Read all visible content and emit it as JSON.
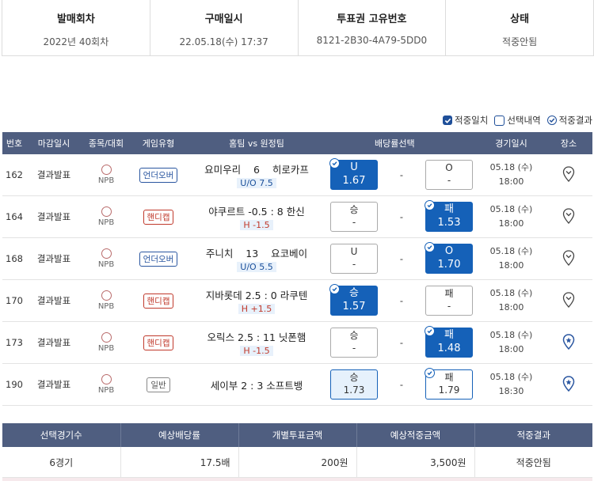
{
  "summary_header": [
    {
      "label": "발매회차",
      "value": "2022년 40회차"
    },
    {
      "label": "구매일시",
      "value": "22.05.18(수) 17:37"
    },
    {
      "label": "투표권 고유번호",
      "value": "8121-2B30-4A79-5DD0"
    },
    {
      "label": "상태",
      "value": "적중안됨"
    }
  ],
  "legend": {
    "hit_match": "적중일치",
    "selection": "선택내역",
    "hit_result": "적중결과"
  },
  "columns": [
    "번호",
    "마감일시",
    "종목/대회",
    "게임유형",
    "홈팀 vs 원정팀",
    "배당률선택",
    "경기일시",
    "장소"
  ],
  "rows": [
    {
      "no": "162",
      "deadline": "결과발표",
      "league": "NPB",
      "type": "언더오버",
      "type_kind": "uo",
      "match": "요미우리    6    히로카프",
      "sub": "U/O 7.5",
      "sub_kind": "uo",
      "left": {
        "label": "U",
        "odds": "1.67",
        "style": "sel",
        "check": true
      },
      "mid": "-",
      "right": {
        "label": "O",
        "odds": "-",
        "style": "plain",
        "check": false
      },
      "date": "05.18 (수)",
      "time": "18:00",
      "pin": "outline"
    },
    {
      "no": "164",
      "deadline": "결과발표",
      "league": "NPB",
      "type": "핸디캡",
      "type_kind": "hd",
      "match": "야쿠르트 -0.5 : 8 한신",
      "sub": "H -1.5",
      "sub_kind": "hd",
      "left": {
        "label": "승",
        "odds": "-",
        "style": "plain",
        "check": false
      },
      "mid": "-",
      "right": {
        "label": "패",
        "odds": "1.53",
        "style": "sel",
        "check": true
      },
      "date": "05.18 (수)",
      "time": "18:00",
      "pin": "outline"
    },
    {
      "no": "168",
      "deadline": "결과발표",
      "league": "NPB",
      "type": "언더오버",
      "type_kind": "uo",
      "match": "주니치    13    요코베이",
      "sub": "U/O 5.5",
      "sub_kind": "uo",
      "left": {
        "label": "U",
        "odds": "-",
        "style": "plain",
        "check": false
      },
      "mid": "-",
      "right": {
        "label": "O",
        "odds": "1.70",
        "style": "sel",
        "check": true
      },
      "date": "05.18 (수)",
      "time": "18:00",
      "pin": "outline"
    },
    {
      "no": "170",
      "deadline": "결과발표",
      "league": "NPB",
      "type": "핸디캡",
      "type_kind": "hd",
      "match": "지바롯데 2.5 : 0 라쿠텐",
      "sub": "H +1.5",
      "sub_kind": "hd",
      "left": {
        "label": "승",
        "odds": "1.57",
        "style": "sel",
        "check": true
      },
      "mid": "-",
      "right": {
        "label": "패",
        "odds": "-",
        "style": "plain",
        "check": false
      },
      "date": "05.18 (수)",
      "time": "18:00",
      "pin": "outline"
    },
    {
      "no": "173",
      "deadline": "결과발표",
      "league": "NPB",
      "type": "핸디캡",
      "type_kind": "hd",
      "match": "오릭스 2.5 : 11 닛폰햄",
      "sub": "H -1.5",
      "sub_kind": "hd",
      "left": {
        "label": "승",
        "odds": "-",
        "style": "plain",
        "check": false
      },
      "mid": "-",
      "right": {
        "label": "패",
        "odds": "1.48",
        "style": "sel",
        "check": true
      },
      "date": "05.18 (수)",
      "time": "18:00",
      "pin": "filled"
    },
    {
      "no": "190",
      "deadline": "결과발표",
      "league": "NPB",
      "type": "일반",
      "type_kind": "gen",
      "match": "세이부 2 : 3 소프트뱅",
      "sub": "",
      "sub_kind": "",
      "left": {
        "label": "승",
        "odds": "1.73",
        "style": "light",
        "check": false
      },
      "mid": "-",
      "right": {
        "label": "패",
        "odds": "1.79",
        "style": "out",
        "check": true
      },
      "date": "05.18 (수)",
      "time": "18:30",
      "pin": "filled"
    }
  ],
  "totals": {
    "headers": [
      "선택경기수",
      "예상배당률",
      "개별투표금액",
      "예상적중금액",
      "적중결과"
    ],
    "values": [
      "6경기",
      "17.5배",
      "200원",
      "3,500원",
      "적중안됨"
    ]
  },
  "colors": {
    "header_bg": "#4f5e80",
    "selected": "#1561b8",
    "handicap": "#c0392b",
    "underover": "#2a56a0"
  }
}
